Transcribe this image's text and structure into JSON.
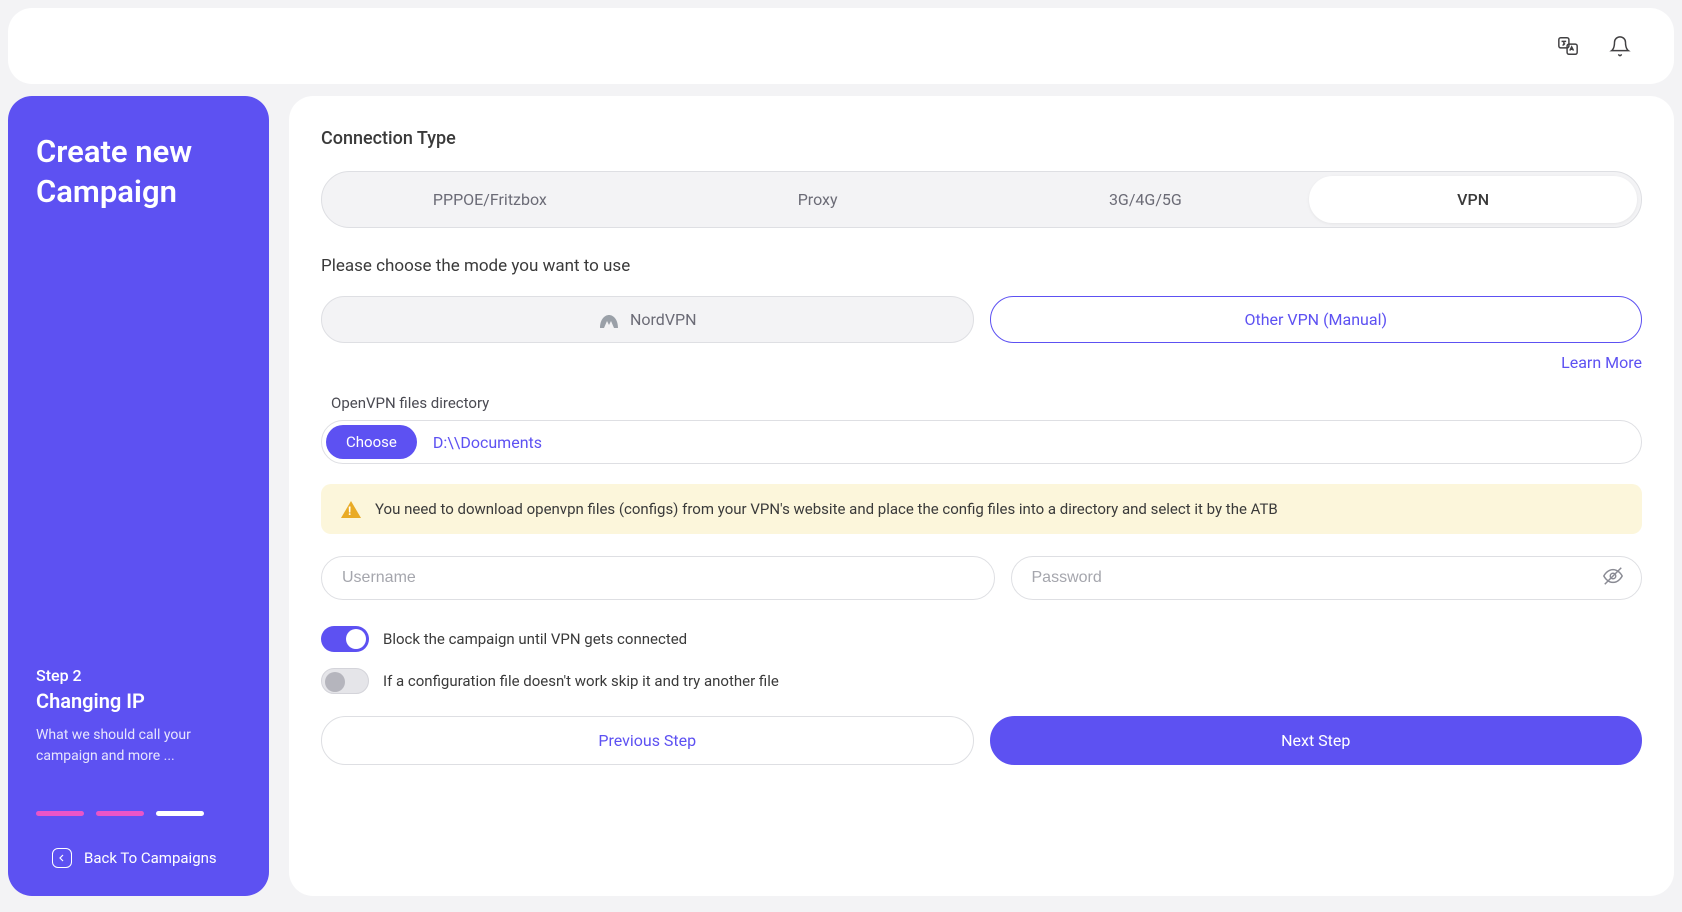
{
  "sidebar": {
    "title": "Create new Campaign",
    "step_label": "Step 2",
    "step_name": "Changing IP",
    "step_desc": "What we should call your campaign and more ...",
    "back_label": "Back To Campaigns"
  },
  "main": {
    "connection_type_label": "Connection Type",
    "tabs": [
      "PPPOE/Fritzbox",
      "Proxy",
      "3G/4G/5G",
      "VPN"
    ],
    "active_tab_index": 3,
    "mode_label": "Please choose the mode you want to use",
    "mode_options": {
      "nord": "NordVPN",
      "other": "Other VPN (Manual)"
    },
    "learn_more": "Learn More",
    "openvpn_label": "OpenVPN files directory",
    "choose_label": "Choose",
    "file_path": "D:\\\\Documents",
    "warning": "You need to download openvpn files (configs) from your VPN's website and place the config files into a directory and select it by the ATB",
    "username_placeholder": "Username",
    "password_placeholder": "Password",
    "toggle_block_label": "Block the campaign until VPN gets connected",
    "toggle_block_on": true,
    "toggle_skip_label": "If a configuration file doesn't work skip it and try another file",
    "toggle_skip_on": false,
    "prev_label": "Previous Step",
    "next_label": "Next Step"
  }
}
